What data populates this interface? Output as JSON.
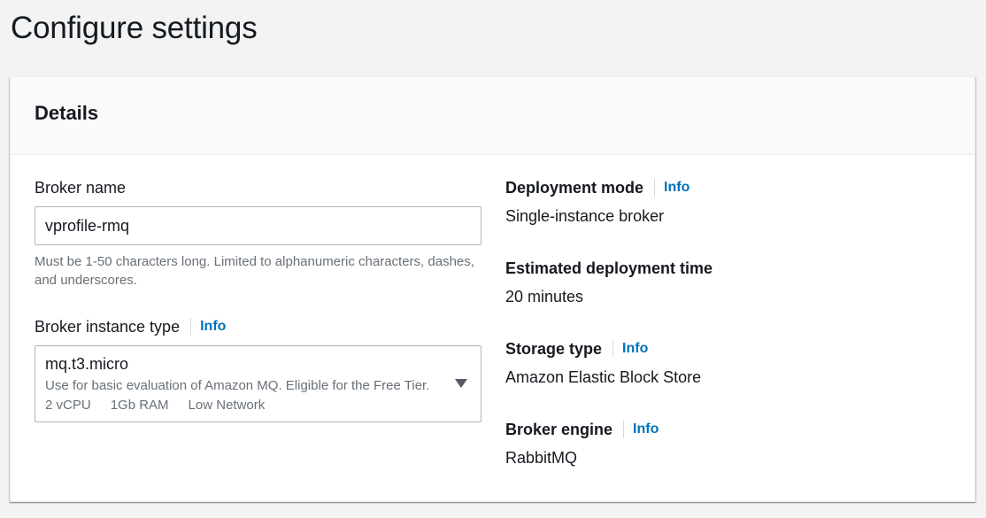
{
  "page": {
    "title": "Configure settings"
  },
  "details": {
    "header": "Details",
    "broker_name": {
      "label": "Broker name",
      "value": "vprofile-rmq",
      "constraint": "Must be 1-50 characters long. Limited to alphanumeric characters, dashes, and underscores."
    },
    "instance_type": {
      "label": "Broker instance type",
      "info": "Info",
      "selected": {
        "title": "mq.t3.micro",
        "description": "Use for basic evaluation of Amazon MQ. Eligible for the Free Tier.",
        "tags": [
          "2 vCPU",
          "1Gb RAM",
          "Low Network"
        ]
      }
    },
    "deployment_mode": {
      "label": "Deployment mode",
      "info": "Info",
      "value": "Single-instance broker"
    },
    "deployment_time": {
      "label": "Estimated deployment time",
      "value": "20 minutes"
    },
    "storage_type": {
      "label": "Storage type",
      "info": "Info",
      "value": "Amazon Elastic Block Store"
    },
    "broker_engine": {
      "label": "Broker engine",
      "info": "Info",
      "value": "RabbitMQ"
    }
  },
  "colors": {
    "link": "#0073bb",
    "background": "#f2f3f3",
    "secondary_text": "#687078"
  },
  "icons": {
    "dropdown": "caret-down-icon"
  }
}
